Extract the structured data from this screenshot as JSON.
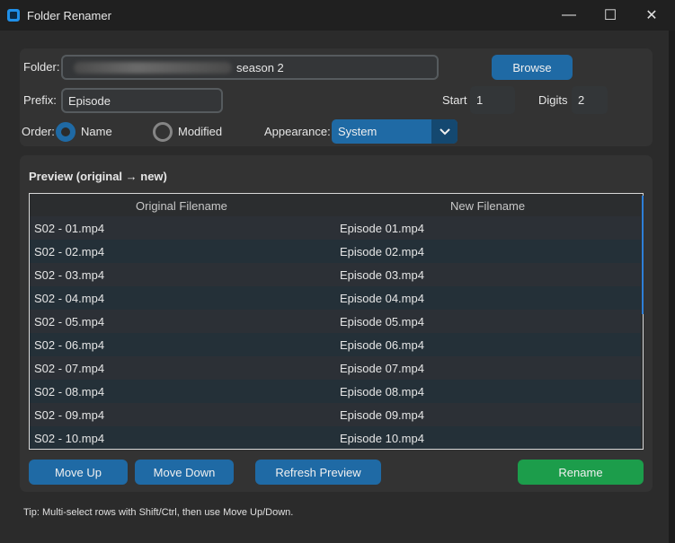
{
  "window": {
    "title": "Folder Renamer",
    "controls": {
      "minimize": "—",
      "maximize": "☐",
      "close": "✕"
    }
  },
  "form": {
    "folder_label": "Folder:",
    "folder_value": "season 2",
    "browse_label": "Browse",
    "prefix_label": "Prefix:",
    "prefix_value": "Episode",
    "start_label": "Start",
    "start_value": "1",
    "digits_label": "Digits",
    "digits_value": "2",
    "order_label": "Order:",
    "order_options": [
      {
        "label": "Name",
        "selected": true
      },
      {
        "label": "Modified",
        "selected": false
      }
    ],
    "appearance_label": "Appearance:",
    "appearance_value": "System"
  },
  "preview": {
    "title": "Preview (original → new)",
    "columns": [
      "Original Filename",
      "New Filename"
    ],
    "rows": [
      [
        "S02 - 01.mp4",
        "Episode 01.mp4"
      ],
      [
        "S02 - 02.mp4",
        "Episode 02.mp4"
      ],
      [
        "S02 - 03.mp4",
        "Episode 03.mp4"
      ],
      [
        "S02 - 04.mp4",
        "Episode 04.mp4"
      ],
      [
        "S02 - 05.mp4",
        "Episode 05.mp4"
      ],
      [
        "S02 - 06.mp4",
        "Episode 06.mp4"
      ],
      [
        "S02 - 07.mp4",
        "Episode 07.mp4"
      ],
      [
        "S02 - 08.mp4",
        "Episode 08.mp4"
      ],
      [
        "S02 - 09.mp4",
        "Episode 09.mp4"
      ],
      [
        "S02 - 10.mp4",
        "Episode 10.mp4"
      ]
    ]
  },
  "actions": {
    "move_up": "Move Up",
    "move_down": "Move Down",
    "refresh": "Refresh Preview",
    "rename": "Rename"
  },
  "tip": "Tip: Multi-select rows with Shift/Ctrl, then use Move Up/Down.",
  "colors": {
    "accent": "#1f6aa5",
    "rename_green": "#1c9d4b",
    "background": "#2b2b2b"
  }
}
